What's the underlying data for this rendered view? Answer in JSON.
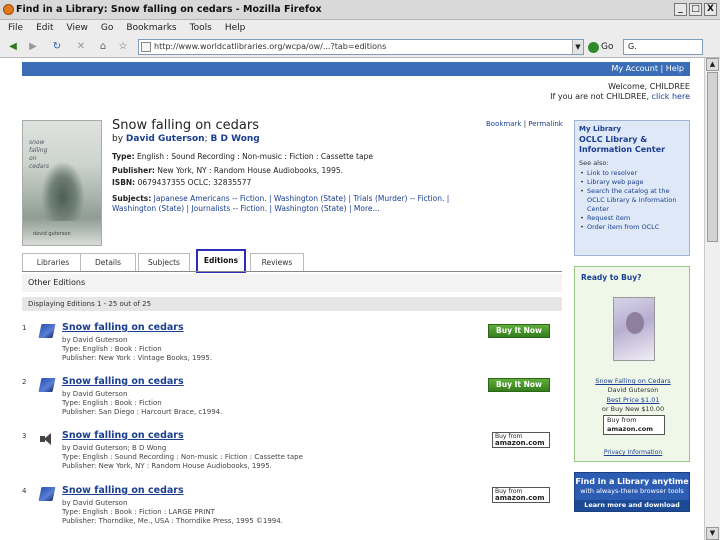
{
  "window": {
    "title": "Find in a Library: Snow falling on cedars - Mozilla Firefox",
    "buttons": [
      "_",
      "□",
      "X"
    ]
  },
  "menu": [
    "File",
    "Edit",
    "View",
    "Go",
    "Bookmarks",
    "Tools",
    "Help"
  ],
  "toolbar": {
    "url": "http://www.worldcatlibraries.org/wcpa/ow/...?tab=editions",
    "go_label": "Go",
    "search_value": "G."
  },
  "topbar": {
    "my_account": "My Account",
    "help": "Help"
  },
  "welcome": {
    "line1": "Welcome, CHILDREE",
    "line2_prefix": "If you are not CHILDREE,",
    "line2_link": "click here"
  },
  "book": {
    "title": "Snow falling on cedars",
    "by": "by",
    "author1": "David Guterson",
    "sep": ";",
    "author2": "B D Wong",
    "type_label": "Type:",
    "type_value": "English : Sound Recording : Non-music : Fiction : Cassette tape",
    "publisher_label": "Publisher:",
    "publisher_value": "New York, NY : Random House Audiobooks, 1995.",
    "isbn_label": "ISBN:",
    "isbn_value": "0679437355   OCLC: 32835577",
    "subjects_label": "Subjects:",
    "subjects_value": "Japanese Americans -- Fiction. | Washington (State) | Trials (Murder) -- Fiction. | Washington (State) | Journalists -- Fiction. | Washington (State) | More...",
    "bookmark": "Bookmark",
    "permalink": "Permalink"
  },
  "tabs": [
    "Libraries",
    "Details",
    "Subjects",
    "Editions",
    "Reviews"
  ],
  "editions": {
    "header": "Other Editions",
    "displaying": "Displaying Editions 1 - 25 out of 25"
  },
  "results": [
    {
      "num": "1",
      "icon": "book-icon",
      "title": "Snow falling on cedars",
      "by": "by David Guterson",
      "type": "Type: English : Book : Fiction",
      "pub": "Publisher: New York : Vintage Books, 1995.",
      "buy": "Buy It Now"
    },
    {
      "num": "2",
      "icon": "book-icon",
      "title": "Snow falling on cedars",
      "by": "by David Guterson",
      "type": "Type: English : Book : Fiction",
      "pub": "Publisher: San Diego : Harcourt Brace, c1994.",
      "buy": "Buy It Now"
    },
    {
      "num": "3",
      "icon": "sound-icon",
      "title": "Snow falling on cedars",
      "by": "by David Guterson; B D Wong",
      "type": "Type: English : Sound Recording : Non-music : Fiction : Cassette tape",
      "pub": "Publisher: New York, NY : Random House Audiobooks, 1995.",
      "buy_top": "Buy from",
      "buy_brand": "amazon.com"
    },
    {
      "num": "4",
      "icon": "book-icon",
      "title": "Snow falling on cedars",
      "by": "by David Guterson",
      "type": "Type: English : Book : Fiction : LARGE PRINT",
      "pub": "Publisher: Thorndike, Me., USA : Thorndike Press, 1995 ©1994.",
      "buy_top": "Buy from",
      "buy_brand": "amazon.com"
    }
  ],
  "mylibrary": {
    "label": "My Library",
    "name": "OCLC Library & Information Center",
    "see": "See also:",
    "links": [
      "Link to resolver",
      "Library web page",
      "Search the catalog at the OCLC Library & Information Center",
      "Request item",
      "Order item from OCLC"
    ]
  },
  "buybox": {
    "heading": "Ready to Buy?",
    "title": "Snow Falling on Cedars",
    "author": "David Guterson",
    "best_price": "Best Price $1.01",
    "buy_new": "or Buy New $10.00",
    "amazon_top": "Buy from",
    "amazon_brand": "amazon.com",
    "privacy": "Privacy Information"
  },
  "promo": {
    "line1": "Find in a Library anytime",
    "line2": "with always-there browser tools",
    "cta": "Learn more and download"
  },
  "colors": {
    "accent": "#3a6db5",
    "tab_highlight": "#2a2fb5",
    "buy_green": "#357e1e"
  }
}
